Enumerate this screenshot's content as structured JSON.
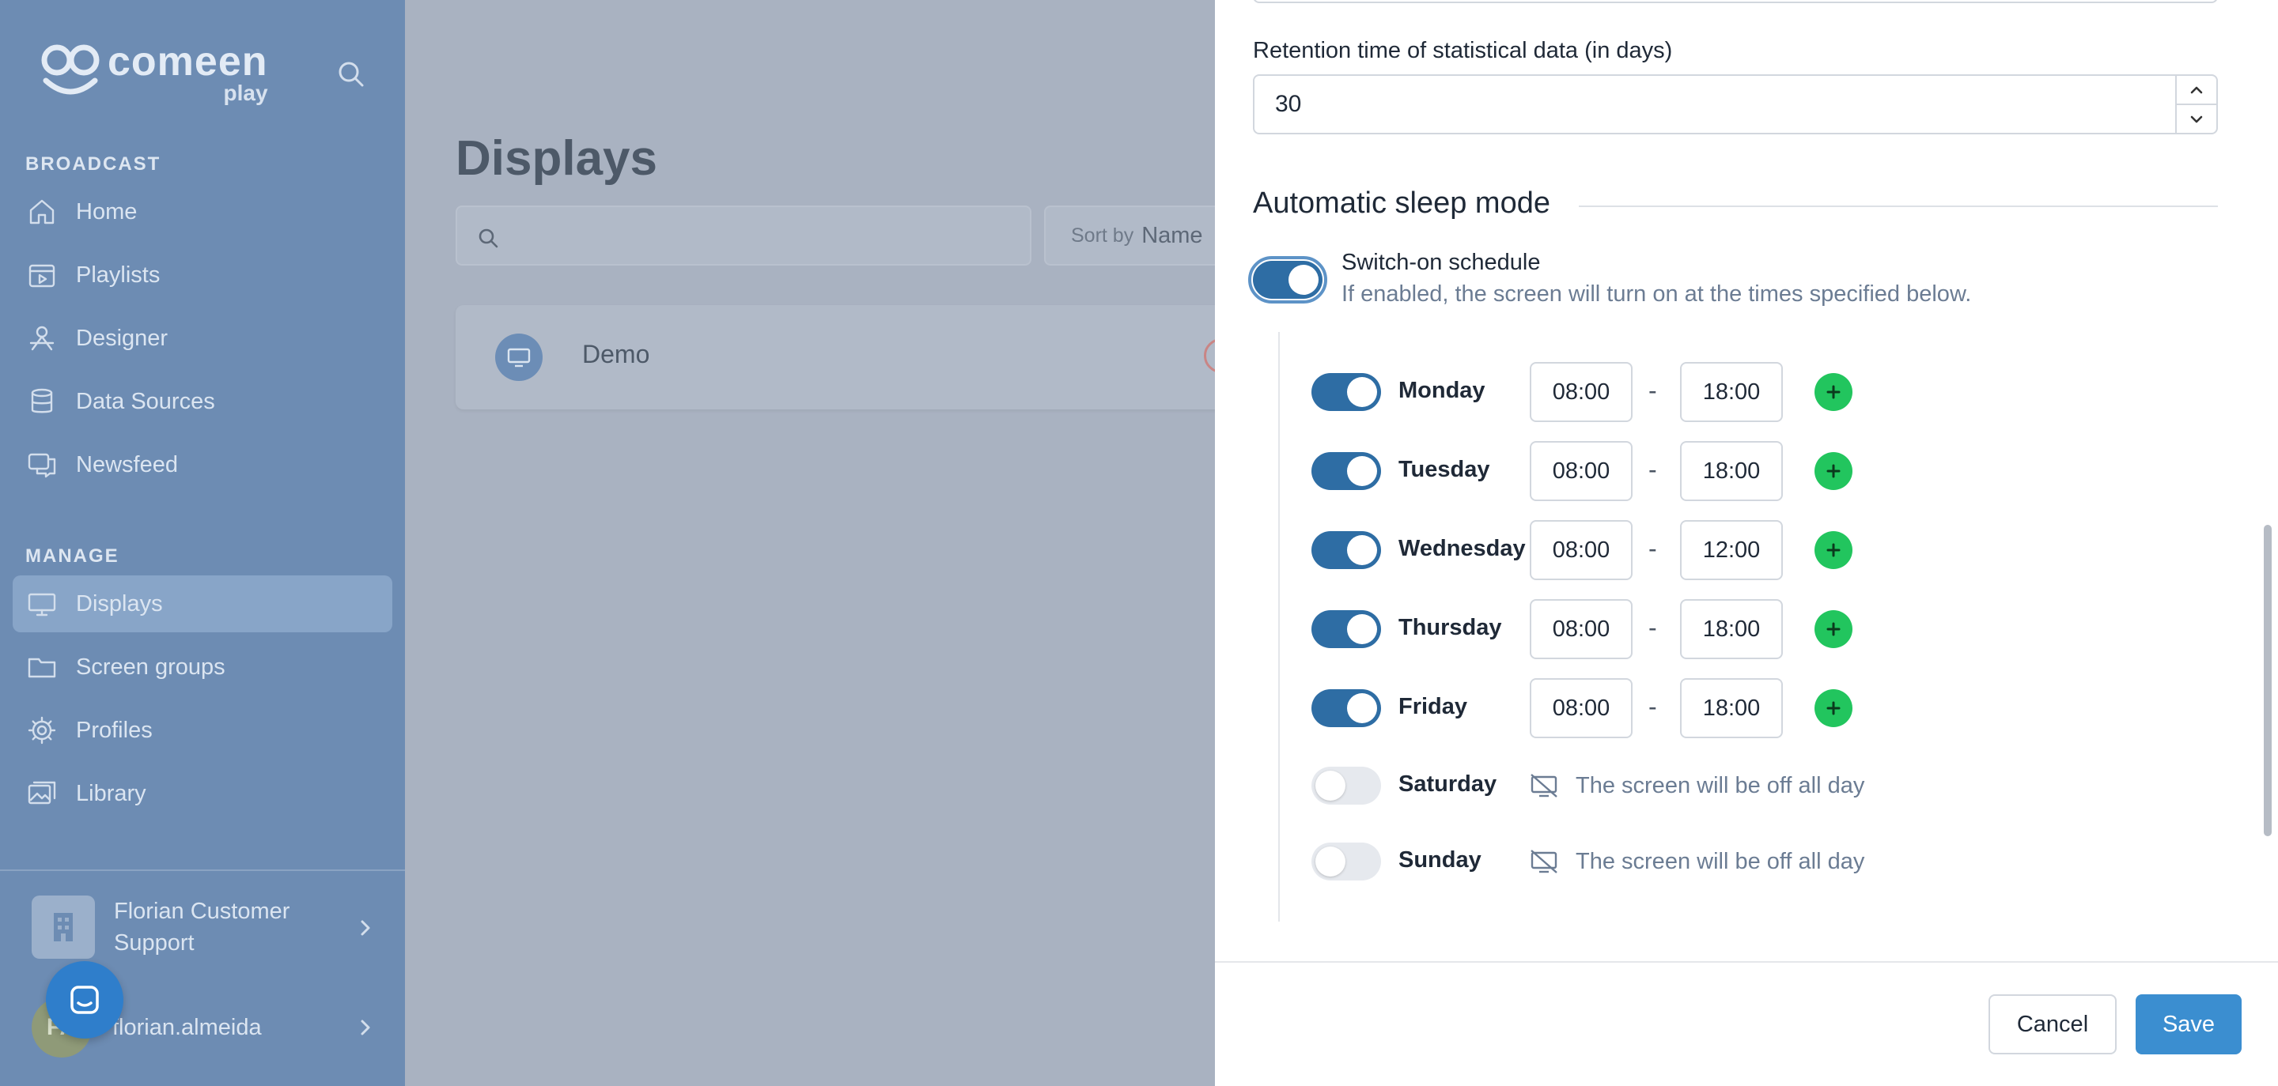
{
  "sidebar": {
    "logo": {
      "brand": "comeen",
      "sub": "play"
    },
    "sections": [
      {
        "label": "BROADCAST"
      },
      {
        "label": "MANAGE"
      }
    ],
    "items": [
      {
        "label": "Home",
        "icon": "home-icon"
      },
      {
        "label": "Playlists",
        "icon": "playlist-icon"
      },
      {
        "label": "Designer",
        "icon": "designer-icon"
      },
      {
        "label": "Data Sources",
        "icon": "database-icon"
      },
      {
        "label": "Newsfeed",
        "icon": "newsfeed-icon"
      },
      {
        "label": "Displays",
        "icon": "monitor-icon",
        "active": true
      },
      {
        "label": "Screen groups",
        "icon": "folder-icon"
      },
      {
        "label": "Profiles",
        "icon": "gear-icon"
      },
      {
        "label": "Library",
        "icon": "image-gallery-icon"
      }
    ],
    "organization": "Florian Customer Support",
    "user": {
      "initials": "FA",
      "name": "florian.almeida"
    }
  },
  "main": {
    "title": "Displays",
    "search": {
      "placeholder": ""
    },
    "sort": {
      "label": "Sort by",
      "value": "Name"
    },
    "displays": [
      {
        "name": "Demo"
      }
    ]
  },
  "panel": {
    "retention": {
      "label": "Retention time of statistical data (in days)",
      "value": "30"
    },
    "sleep_mode": {
      "title": "Automatic sleep mode",
      "schedule_enabled": true,
      "schedule_title": "Switch-on schedule",
      "schedule_hint": "If enabled, the screen will turn on at the times specified below.",
      "days": [
        {
          "name": "Monday",
          "enabled": true,
          "start": "08:00",
          "end": "18:00"
        },
        {
          "name": "Tuesday",
          "enabled": true,
          "start": "08:00",
          "end": "18:00"
        },
        {
          "name": "Wednesday",
          "enabled": true,
          "start": "08:00",
          "end": "12:00"
        },
        {
          "name": "Thursday",
          "enabled": true,
          "start": "08:00",
          "end": "18:00"
        },
        {
          "name": "Friday",
          "enabled": true,
          "start": "08:00",
          "end": "18:00"
        },
        {
          "name": "Saturday",
          "enabled": false,
          "off_text": "The screen will be off all day"
        },
        {
          "name": "Sunday",
          "enabled": false,
          "off_text": "The screen will be off all day"
        }
      ],
      "separator": "-"
    },
    "buttons": {
      "cancel": "Cancel",
      "save": "Save"
    }
  },
  "colors": {
    "sidebar_bg": "#6d8cb3",
    "accent": "#2e6da4",
    "save_button": "#3b8ed0",
    "add_button": "#22c55e"
  }
}
